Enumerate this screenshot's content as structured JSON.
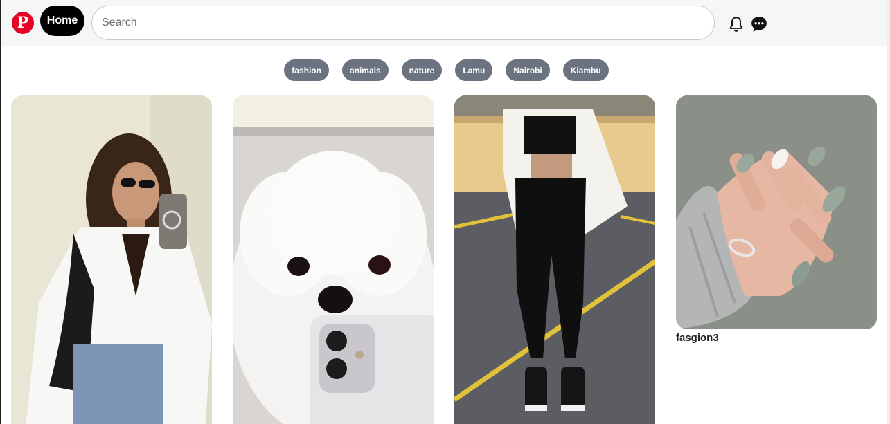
{
  "header": {
    "logo_glyph": "P",
    "home_label": "Home",
    "search_placeholder": "Search",
    "icons": [
      "notification-bell-icon",
      "chat-bubble-icon"
    ]
  },
  "categories": [
    {
      "label": "fashion"
    },
    {
      "label": "animals"
    },
    {
      "label": "nature"
    },
    {
      "label": "Lamu"
    },
    {
      "label": "Nairobi"
    },
    {
      "label": "Kiambu"
    }
  ],
  "pins": [
    {
      "subject": "woman-white-shirt-mirror-selfie"
    },
    {
      "subject": "white-fluffy-dog"
    },
    {
      "subject": "woman-black-outfit-parking-lot"
    },
    {
      "subject": "green-manicure-nails",
      "caption": "fasgion3"
    }
  ],
  "colors": {
    "brand": "#e60023",
    "chip_bg": "#6b7280",
    "header_bg": "#f5f6f8"
  }
}
